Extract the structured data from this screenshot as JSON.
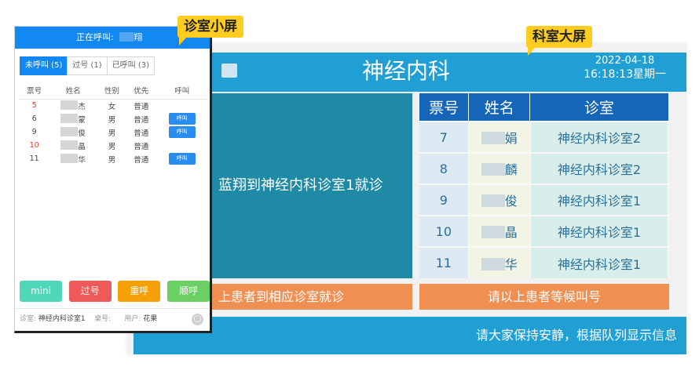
{
  "labels": {
    "small_screen": "诊室小屏",
    "big_screen": "科室大屏"
  },
  "big": {
    "title": "神经内科",
    "date": "2022-04-18",
    "time": "16:18:13星期一",
    "calling_message": "蓝翔到神经内科诊室1就诊",
    "table_headers": [
      "票号",
      "姓名",
      "诊室"
    ],
    "rows": [
      {
        "ticket": "7",
        "name": "娟",
        "room": "神经内科诊室2"
      },
      {
        "ticket": "8",
        "name": "麟",
        "room": "神经内科诊室2"
      },
      {
        "ticket": "9",
        "name": "俊",
        "room": "神经内科诊室1"
      },
      {
        "ticket": "10",
        "name": "晶",
        "room": "神经内科诊室1"
      },
      {
        "ticket": "11",
        "name": "华",
        "room": "神经内科诊室1"
      }
    ],
    "footer_left": "上患者到相应诊室就诊",
    "footer_right": "请以上患者等候叫号",
    "ticker": "请大家保持安静，根据队列显示信息"
  },
  "small": {
    "calling_label": "正在呼叫:",
    "calling_name": "翔",
    "tabs": [
      "未呼叫 (5)",
      "过号 (1)",
      "已呼叫 (3)"
    ],
    "headers": [
      "票号",
      "姓名",
      "性别",
      "优先",
      "呼叫"
    ],
    "rows": [
      {
        "ticket": "5",
        "name": "杰",
        "gender": "女",
        "priority": "普通",
        "call": ""
      },
      {
        "ticket": "6",
        "name": "蒙",
        "gender": "男",
        "priority": "普通",
        "call": "呼叫"
      },
      {
        "ticket": "9",
        "name": "俊",
        "gender": "男",
        "priority": "普通",
        "call": "呼叫"
      },
      {
        "ticket": "10",
        "name": "晶",
        "gender": "男",
        "priority": "普通",
        "call": ""
      },
      {
        "ticket": "11",
        "name": "华",
        "gender": "男",
        "priority": "普通",
        "call": "呼叫"
      }
    ],
    "buttons": {
      "mini": "mini",
      "skip": "过号",
      "recall": "重呼",
      "sequential": "顺呼"
    },
    "status": {
      "room_label": "诊室:",
      "room_value": "神经内科诊室1",
      "desk_label": "桌号:",
      "user_label": "用户:",
      "user_value": "花果"
    }
  },
  "colors": {
    "big_header": "#1f9fd4",
    "big_message": "#1e8aa6",
    "table_header": "#1565b8",
    "footer_orange": "#f08f52",
    "small_top": "#1189f0",
    "callout_yellow": "#ffcd1f"
  }
}
